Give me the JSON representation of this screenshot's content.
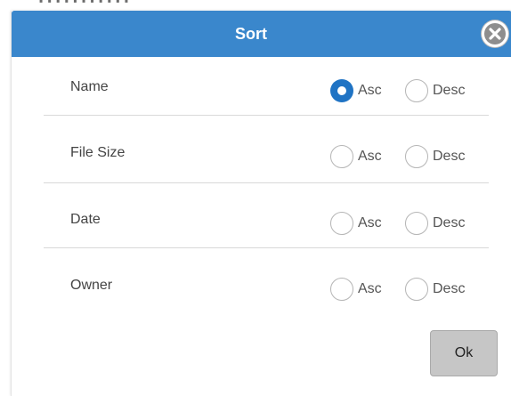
{
  "dialog": {
    "title": "Sort",
    "close_icon": "close-circle-icon",
    "ok_label": "Ok",
    "accent_color": "#3a87cc",
    "selected_radio_color": "#1f73c4"
  },
  "sort_options": [
    {
      "field": "Name",
      "asc_label": "Asc",
      "desc_label": "Desc",
      "selected": "asc"
    },
    {
      "field": "File Size",
      "asc_label": "Asc",
      "desc_label": "Desc",
      "selected": null
    },
    {
      "field": "Date",
      "asc_label": "Asc",
      "desc_label": "Desc",
      "selected": null
    },
    {
      "field": "Owner",
      "asc_label": "Asc",
      "desc_label": "Desc",
      "selected": null
    }
  ]
}
